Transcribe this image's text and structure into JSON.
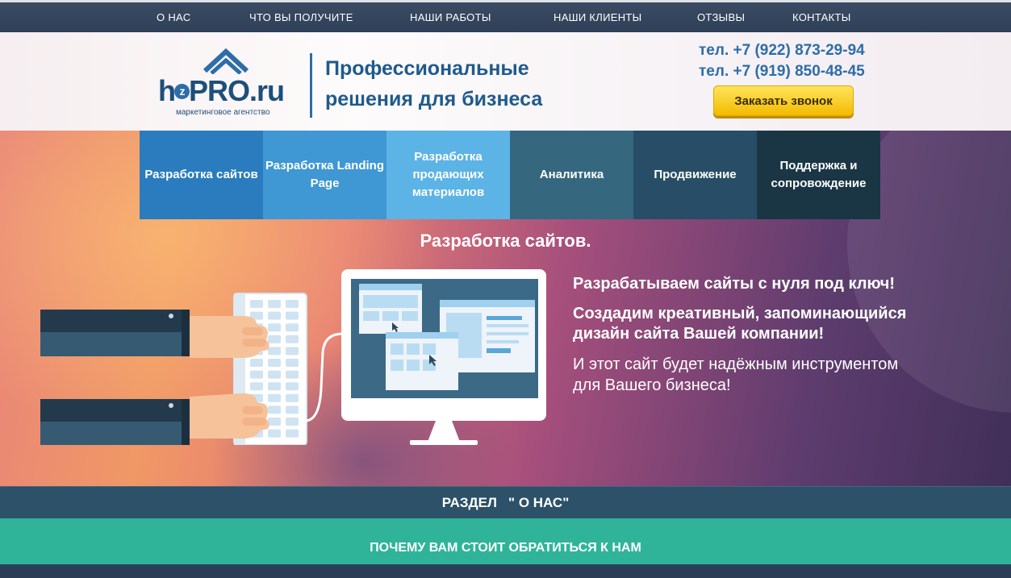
{
  "topnav": {
    "items": [
      "О  НАС",
      "ЧТО ВЫ ПОЛУЧИТЕ",
      "НАШИ РАБОТЫ",
      "НАШИ КЛИЕНТЫ",
      "ОТЗЫВЫ",
      "КОНТАКТЫ"
    ]
  },
  "header": {
    "logo": {
      "brand_left": "h",
      "brand_z": "z",
      "brand_right": "PRO.ru",
      "subtitle": "маркетинговое агентство"
    },
    "tagline_line1": "Профессиональные",
    "tagline_line2": "решения для бизнеса",
    "phone1": "тел. +7 (922) 873-29-94",
    "phone2": "тел. +7 (919) 850-48-45",
    "call_button": "Заказать звонок"
  },
  "services": [
    {
      "label": "Разработка сайтов",
      "color": "#2a7cbe"
    },
    {
      "label": "Разработка Landing  Page",
      "color": "#3f97d3"
    },
    {
      "label": "Разработка продающих материалов",
      "color": "#5cb3e6"
    },
    {
      "label": "Аналитика",
      "color": "#35677f"
    },
    {
      "label": "Продвижение",
      "color": "#274e66"
    },
    {
      "label": "Поддержка и сопровождение",
      "color": "#1a3645"
    }
  ],
  "hero": {
    "title": "Разработка сайтов.",
    "para1": "Разрабатываем сайты с нуля под ключ!",
    "para2": "Создадим креативный, запоминающийся дизайн сайта Вашей компании!",
    "para3": "И этот сайт будет надёжным инструментом для Вашего бизнеса!"
  },
  "sections": {
    "about": "РАЗДЕЛ   \" О НАС\"",
    "why_us": "ПОЧЕМУ ВАМ СТОИТ ОБРАТИТЬСЯ К НАМ"
  },
  "colors": {
    "accent": "#2d6da8",
    "call_button": "#ffd21f",
    "about_bar": "#2c5168",
    "why_bar": "#2fb49a"
  }
}
